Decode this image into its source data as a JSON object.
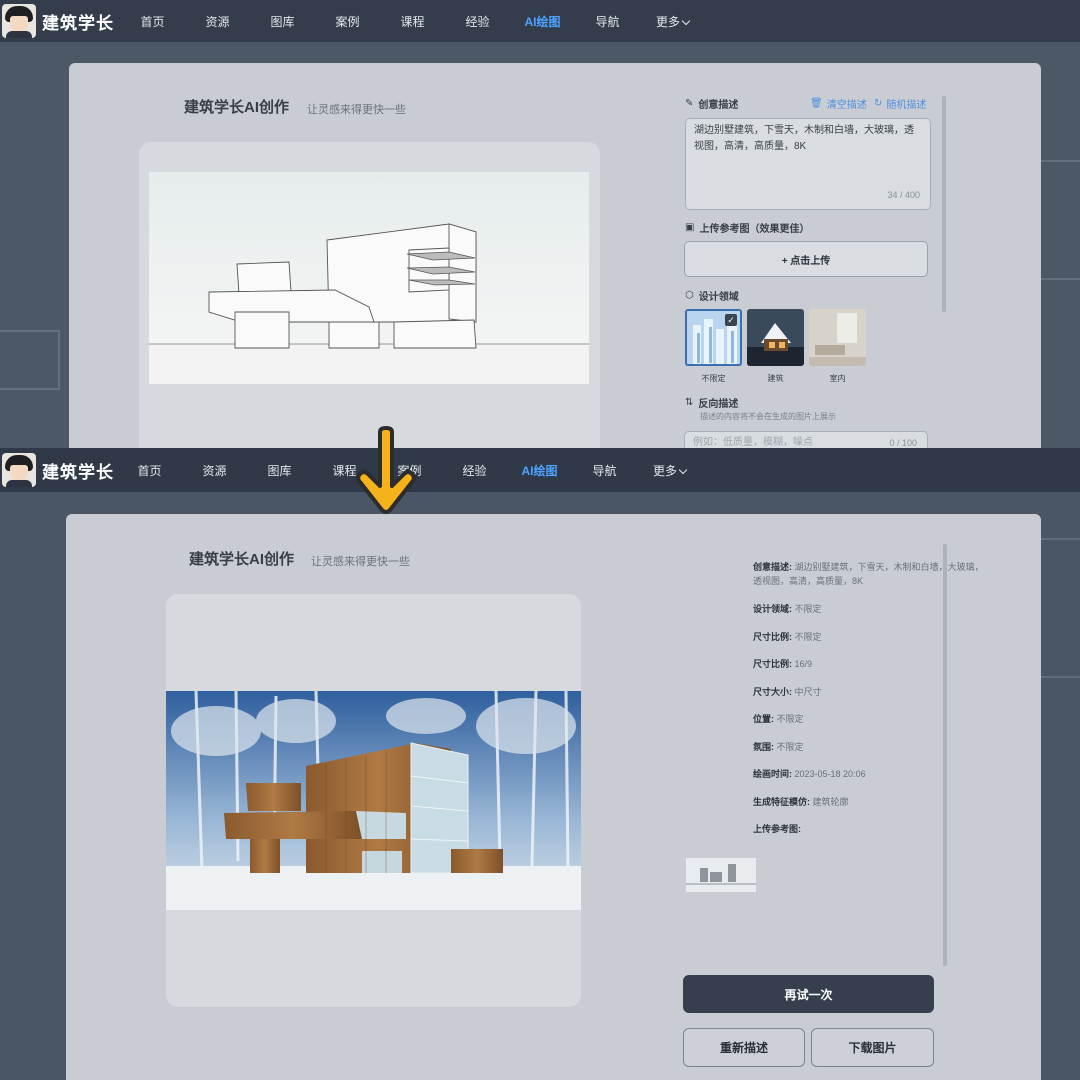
{
  "nav": {
    "brand": "建筑学长",
    "items": [
      "首页",
      "资源",
      "图库",
      "案例",
      "课程",
      "经验",
      "AI绘图",
      "导航",
      "更多"
    ],
    "active_index": 6
  },
  "top": {
    "title": "建筑学长AI创作",
    "subtitle": "让灵感来得更快一些",
    "creative_label": "创意描述",
    "clear_link": "清空描述",
    "random_link": "随机描述",
    "prompt_text": "湖边别墅建筑，下雪天，木制和白墙，大玻璃，透视图，高清，高质量，8K",
    "prompt_count": "34 / 400",
    "upload_label": "上传参考图（效果更佳）",
    "upload_button": "+ 点击上传",
    "domain_label": "设计领域",
    "domains": [
      "不限定",
      "建筑",
      "室内"
    ],
    "negative_label": "反向描述",
    "negative_hint": "描述的内容将不会在生成的图片上展示",
    "negative_placeholder": "例如：低质量，模糊，噪点",
    "negative_count": "0 / 100"
  },
  "bottom": {
    "title": "建筑学长AI创作",
    "subtitle": "让灵感来得更快一些",
    "info": [
      {
        "key": "创意描述:",
        "value": "湖边别墅建筑，下雪天，木制和白墙，大玻璃，透视图，高清，高质量，8K"
      },
      {
        "key": "设计领域:",
        "value": "不限定"
      },
      {
        "key": "尺寸比例:",
        "value": "不限定"
      },
      {
        "key": "尺寸比例:",
        "value": "16/9"
      },
      {
        "key": "尺寸大小:",
        "value": "中尺寸"
      },
      {
        "key": "位置:",
        "value": "不限定"
      },
      {
        "key": "氛围:",
        "value": "不限定"
      },
      {
        "key": "绘画时间:",
        "value": "2023-05-18 20:06"
      },
      {
        "key": "生成特征模仿:",
        "value": "建筑轮廓"
      },
      {
        "key": "上传参考图:",
        "value": ""
      }
    ],
    "retry_button": "再试一次",
    "redescribe_button": "重新描述",
    "download_button": "下载图片"
  },
  "colors": {
    "navbar": "#333d4b",
    "active_nav": "#4da3ff",
    "arrow": "#f5b21b",
    "panel": "#c9cdd3",
    "primary_button": "#353f4d"
  }
}
